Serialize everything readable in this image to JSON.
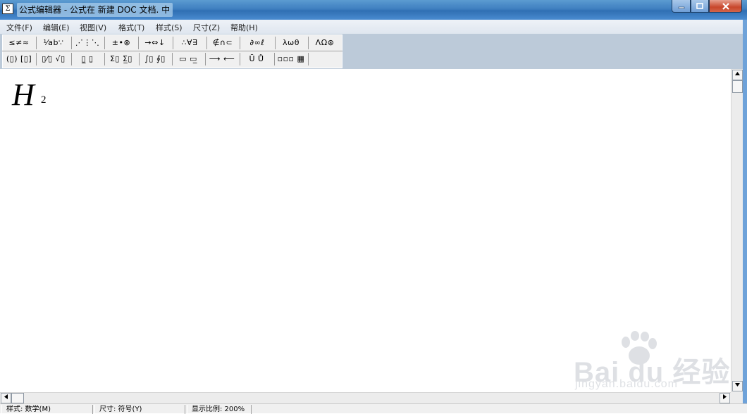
{
  "window": {
    "title": "公式编辑器 - 公式在 新建 DOC 文档. 中"
  },
  "menu": [
    {
      "label": "文件(F)"
    },
    {
      "label": "编辑(E)"
    },
    {
      "label": "视图(V)"
    },
    {
      "label": "格式(T)"
    },
    {
      "label": "样式(S)"
    },
    {
      "label": "尺寸(Z)"
    },
    {
      "label": "帮助(H)"
    }
  ],
  "palette_row1": [
    {
      "symbol": "≤≠≈"
    },
    {
      "symbol": "⅟ab∵"
    },
    {
      "symbol": "⋰⋮⋱"
    },
    {
      "symbol": "±•⊗"
    },
    {
      "symbol": "→⇔↓"
    },
    {
      "symbol": "∴∀∃"
    },
    {
      "symbol": "∉∩⊂"
    },
    {
      "symbol": "∂∞ℓ"
    },
    {
      "symbol": "λωθ"
    },
    {
      "symbol": "ΛΩ⊛"
    }
  ],
  "palette_row2": [
    {
      "symbol": "(▯) [▯]"
    },
    {
      "symbol": "▯⁄▯ √▯"
    },
    {
      "symbol": "▯̲ ▯̱"
    },
    {
      "symbol": "Σ▯ Σ̲▯"
    },
    {
      "symbol": "∫▯ ∮▯"
    },
    {
      "symbol": "▭ ▭̲"
    },
    {
      "symbol": "⟶ ⟵"
    },
    {
      "symbol": "Ū Ů"
    },
    {
      "symbol": "▫▫▫ ▦"
    }
  ],
  "equation": {
    "base": "H",
    "subscript": "2"
  },
  "status": {
    "style": "样式: 数学(M)",
    "size": "尺寸: 符号(Y)",
    "zoom": "显示比例: 200%"
  },
  "watermark": {
    "brand": "Bai du 经验",
    "url": "jingyan.baidu.com"
  }
}
